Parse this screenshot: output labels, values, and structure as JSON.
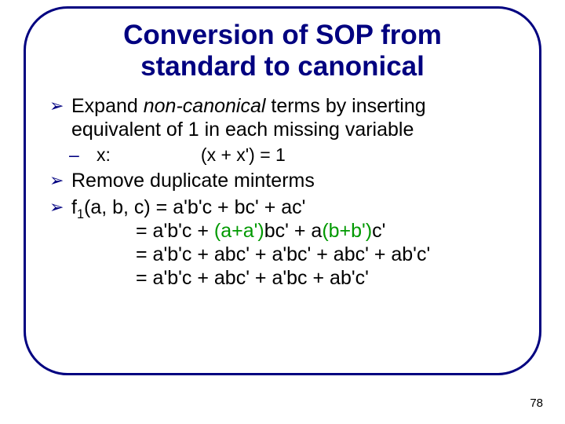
{
  "title_line1": "Conversion of SOP from",
  "title_line2": "standard to canonical",
  "b1_pre": "Expand ",
  "b1_italic": "non-canonical",
  "b1_post": " terms by inserting equivalent of 1 in each missing variable",
  "sub_text": "x:                  (x + x') = 1",
  "b2": "Remove duplicate minterms",
  "f_label_pre": "f",
  "f_sub": "1",
  "f_args": "(a, b, c) = a'b'c + bc' + ac'",
  "eq2_pre": "= a'b'c + ",
  "eq2_g1": "(a+a')",
  "eq2_mid": "bc' + a",
  "eq2_g2": "(b+b')",
  "eq2_post": "c'",
  "eq3": "= a'b'c + abc' + a'bc' + abc' + ab'c'",
  "eq4": "= a'b'c + abc' + a'bc + ab'c'",
  "page_number": "78",
  "arrow_glyph": "➢",
  "dash_glyph": "–"
}
